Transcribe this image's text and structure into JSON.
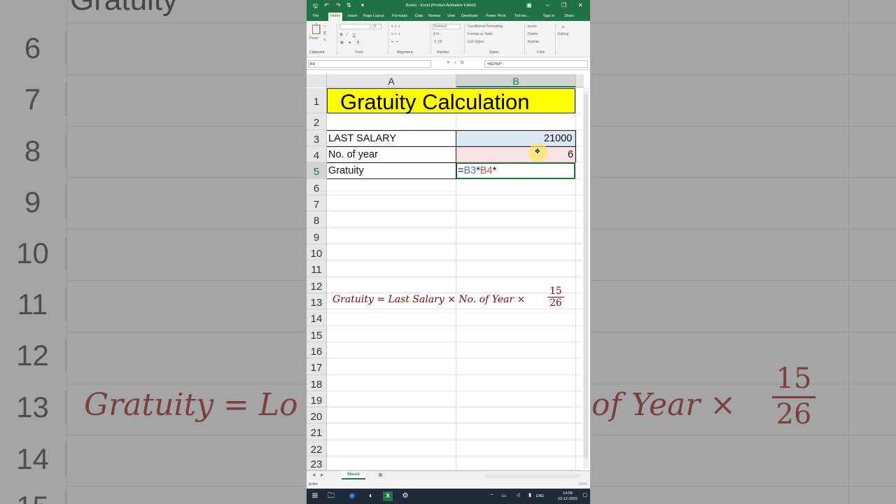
{
  "window": {
    "title": "Book1 - Excel (Product Activation Failed)",
    "sign_in": "Sign in",
    "share": "Share"
  },
  "ribbon": {
    "tabs": [
      "File",
      "Home",
      "Insert",
      "Page Layout",
      "Formulas",
      "Data",
      "Review",
      "View",
      "Developer",
      "Power Pivot",
      "Tell me..."
    ],
    "active_tab": "Home",
    "groups": {
      "clipboard": "Clipboard",
      "paste": "Paste",
      "font": "Font",
      "font_size": "11",
      "alignment": "Alignment",
      "number": "Number",
      "number_format": "General",
      "styles": "Styles",
      "conditional_formatting": "Conditional Formatting",
      "format_as_table": "Format as Table",
      "cell_styles": "Cell Styles",
      "cells": "Cells",
      "insert": "Insert",
      "delete": "Delete",
      "format": "Format",
      "editing": "Editing"
    }
  },
  "formula_bar": {
    "name_box": "B4",
    "formula": "=B3*B4*"
  },
  "grid": {
    "columns": [
      "A",
      "B"
    ],
    "selected_column": "B",
    "rows": [
      "1",
      "2",
      "3",
      "4",
      "5",
      "6",
      "7",
      "8",
      "9",
      "10",
      "11",
      "12",
      "13",
      "14",
      "15",
      "16",
      "17",
      "18",
      "19",
      "20",
      "21",
      "22",
      "23"
    ],
    "selected_row": "5",
    "title": "Gratuity Calculation",
    "a3": "LAST SALARY",
    "b3": "21000",
    "a4": "No. of year",
    "b4": "6",
    "a5": "Gratuity",
    "b5_parts": {
      "eq": "=",
      "ref1": "B3",
      "star1": "*",
      "ref2": "B4",
      "star2": "*"
    },
    "formula_note": "Gratuity = Last Salary  × No. of Year  ×",
    "fraction_num": "15",
    "fraction_den": "26"
  },
  "sheet": {
    "tab": "Sheet1",
    "status": "Enter",
    "zoom": "220%"
  },
  "taskbar": {
    "lang": "ENG",
    "time": "14:09",
    "date": "13-12-2022"
  },
  "background": {
    "rows": [
      "6",
      "7",
      "8",
      "9",
      "10",
      "11",
      "12",
      "13",
      "14",
      "15"
    ],
    "title_fragment": "Gratuity",
    "formula_left": "Gratuity = Lo",
    "formula_right": "of Year ×",
    "frac_num": "15",
    "frac_den": "26"
  },
  "colors": {
    "excel_green": "#217346",
    "title_fill": "#ffff00",
    "ref1_color": "#4472c4",
    "ref2_color": "#c0504d",
    "formula_text": "#8b0000"
  }
}
